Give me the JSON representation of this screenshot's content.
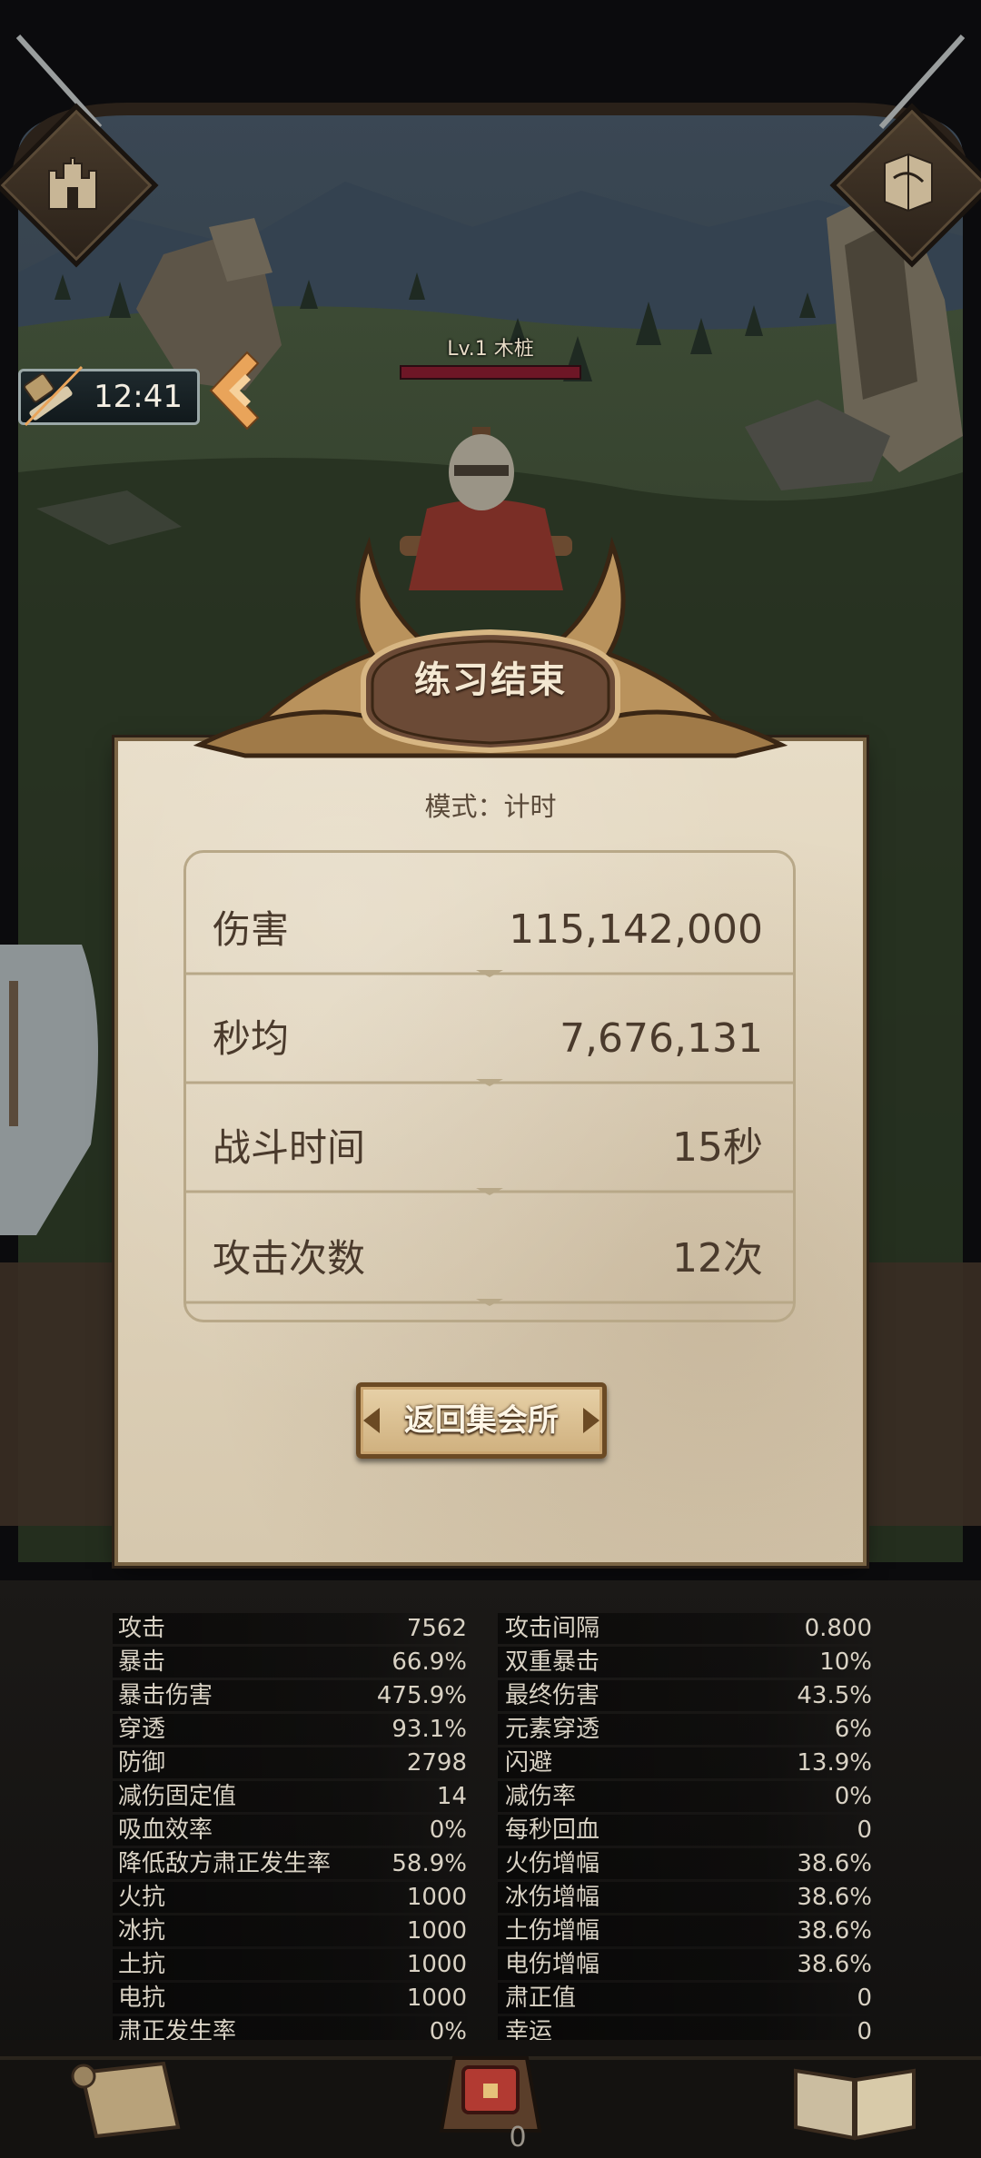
{
  "timer": {
    "value": "12:41"
  },
  "enemy": {
    "label": "Lv.1 木桩"
  },
  "result": {
    "title": "练习结束",
    "mode": "模式：计时",
    "stats": [
      {
        "label": "伤害",
        "value": "115,142,000"
      },
      {
        "label": "秒均",
        "value": "7,676,131"
      },
      {
        "label": "战斗时间",
        "value": "15秒"
      },
      {
        "label": "攻击次数",
        "value": "12次"
      }
    ],
    "return_button": "返回集会所"
  },
  "attributes": [
    {
      "left_label": "攻击",
      "left_value": "7562",
      "right_label": "攻击间隔",
      "right_value": "0.800"
    },
    {
      "left_label": "暴击",
      "left_value": "66.9%",
      "right_label": "双重暴击",
      "right_value": "10%"
    },
    {
      "left_label": "暴击伤害",
      "left_value": "475.9%",
      "right_label": "最终伤害",
      "right_value": "43.5%"
    },
    {
      "left_label": "穿透",
      "left_value": "93.1%",
      "right_label": "元素穿透",
      "right_value": "6%"
    },
    {
      "left_label": "防御",
      "left_value": "2798",
      "right_label": "闪避",
      "right_value": "13.9%"
    },
    {
      "left_label": "减伤固定值",
      "left_value": "14",
      "right_label": "减伤率",
      "right_value": "0%"
    },
    {
      "left_label": "吸血效率",
      "left_value": "0%",
      "right_label": "每秒回血",
      "right_value": "0"
    },
    {
      "left_label": "降低敌方肃正发生率",
      "left_value": "58.9%",
      "right_label": "火伤增幅",
      "right_value": "38.6%"
    },
    {
      "left_label": "火抗",
      "left_value": "1000",
      "right_label": "冰伤增幅",
      "right_value": "38.6%"
    },
    {
      "left_label": "冰抗",
      "left_value": "1000",
      "right_label": "土伤增幅",
      "right_value": "38.6%"
    },
    {
      "left_label": "土抗",
      "left_value": "1000",
      "right_label": "电伤增幅",
      "right_value": "38.6%"
    },
    {
      "left_label": "电抗",
      "left_value": "1000",
      "right_label": "肃正值",
      "right_value": "0"
    },
    {
      "left_label": "肃正发生率",
      "left_value": "0%",
      "right_label": "幸运",
      "right_value": "0"
    }
  ],
  "bottom_nav": {
    "count": "0"
  },
  "colors": {
    "parchment": "#e2d6bf",
    "frame_bronze": "#8a6a40",
    "hp_bar": "#6e1626",
    "accent_orange": "#e9a45a"
  },
  "icons": [
    "castle-icon",
    "map-icon",
    "training-hammer-icon",
    "chest-icon",
    "book-icon",
    "scroll-icon"
  ]
}
